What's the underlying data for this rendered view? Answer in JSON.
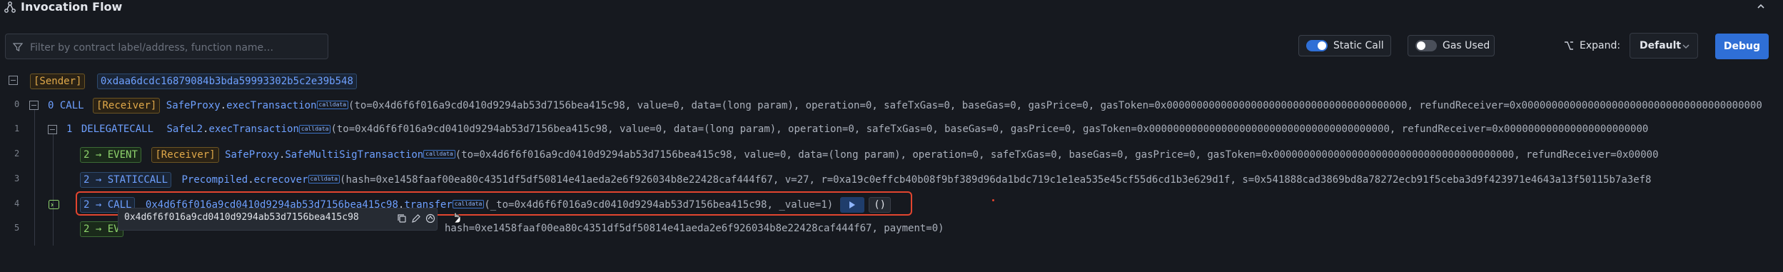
{
  "header": {
    "title": "Invocation Flow",
    "icon": "flow-icon"
  },
  "toolbar": {
    "filter_placeholder": "Filter by contract label/address, function name…",
    "static_call_label": "Static Call",
    "static_call_on": true,
    "gas_used_label": "Gas Used",
    "gas_used_on": false,
    "expand_label": "Expand:",
    "expand_value": "Default",
    "debug_label": "Debug"
  },
  "colors": {
    "accent": "#2f6fd6",
    "highlight": "#e2452f",
    "event": "#8fd46d",
    "label": "#e0a94a"
  },
  "sender": {
    "label": "[Sender]",
    "address": "0xdaa6dcdc16879084b3bda59993302b5c2e39b548"
  },
  "rows": [
    {
      "line": "0",
      "depth": "0",
      "type": "CALL",
      "contract": "[Receiver]",
      "target": "SafeProxy",
      "method": "execTransaction",
      "tag": "calldata",
      "args": "(to=0x4d6f6f016a9cd0410d9294ab53d7156bea415c98, value=0, data=(long param), operation=0, safeTxGas=0, baseGas=0, gasPrice=0, gasToken=0x0000000000000000000000000000000000000000, refundReceiver=0x0000000000000000000000000000000000000000"
    },
    {
      "line": "1",
      "depth": "1",
      "type": "DELEGATECALL",
      "target": "SafeL2",
      "method": "execTransaction",
      "tag": "calldata",
      "args": "(to=0x4d6f6f016a9cd0410d9294ab53d7156bea415c98, value=0, data=(long param), operation=0, safeTxGas=0, baseGas=0, gasPrice=0, gasToken=0x0000000000000000000000000000000000000000, refundReceiver=0x000000000000000000000000"
    },
    {
      "line": "2",
      "depth": "2",
      "type": "EVENT",
      "contract": "[Receiver]",
      "target": "SafeProxy",
      "method": "SafeMultiSigTransaction",
      "tag": "calldata",
      "args": "(to=0x4d6f6f016a9cd0410d9294ab53d7156bea415c98, value=0, data=(long param), operation=0, safeTxGas=0, baseGas=0, gasPrice=0, gasToken=0x0000000000000000000000000000000000000000, refundReceiver=0x00000"
    },
    {
      "line": "3",
      "depth": "2",
      "type": "STATICCALL",
      "target": "Precompiled",
      "method": "ecrecover",
      "tag": "calldata",
      "args": "(hash=0xe1458faaf00ea80c4351df5df50814e41aeda2e6f926034b8e22428caf444f67, v=27, r=0xa19c0effcb40b08f9bf389d96da1bdc719c1e1ea535e45cf55d6cd1b3e629d1f, s=0x541888cad3869bd8a78272ecb91f5ceba3d9f423971e4643a13f50115b7a3ef8"
    },
    {
      "line": "4",
      "depth": "2",
      "type": "CALL",
      "target": "0x4d6f6f016a9cd0410d9294ab53d7156bea415c98",
      "method": "transfer",
      "tag": "calldata",
      "args": "(_to=0x4d6f6f016a9cd0410d9294ab53d7156bea415c98, _value=1)",
      "return": "()"
    },
    {
      "line": "5",
      "depth": "2",
      "type": "EV",
      "args": "hash=0xe1458faaf00ea80c4351df5df50814e41aeda2e6f926034b8e22428caf444f67, payment=0)"
    }
  ],
  "tooltip": {
    "address": "0x4d6f6f016a9cd0410d9294ab53d7156bea415c98"
  }
}
